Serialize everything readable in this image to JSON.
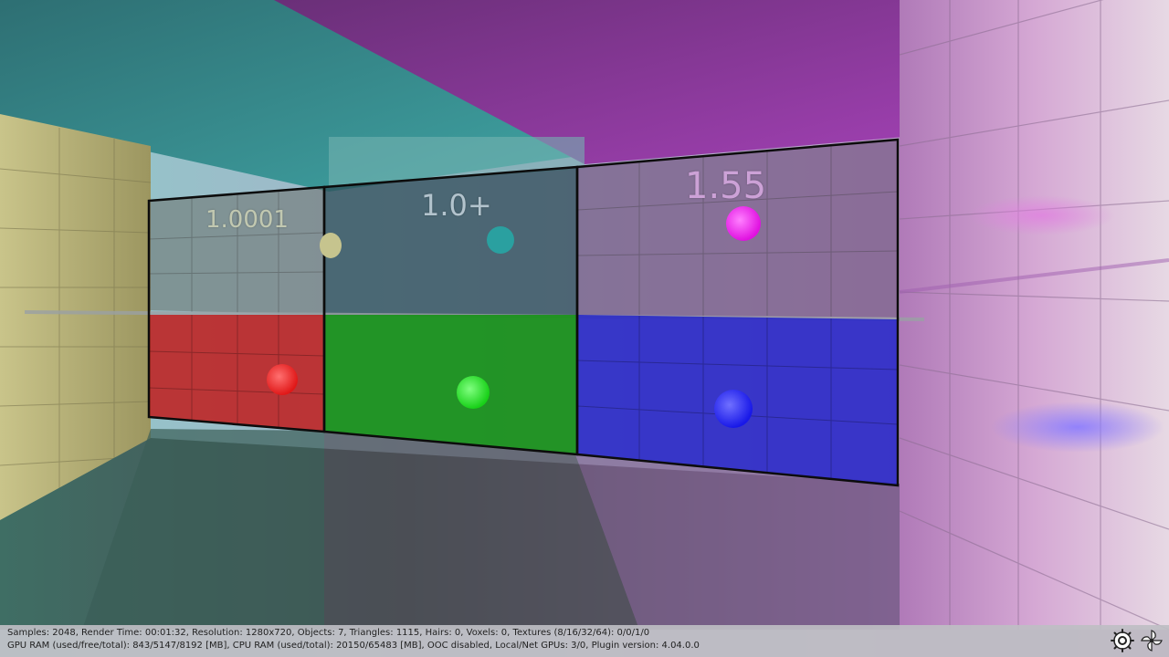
{
  "viewport": {
    "ior_labels": {
      "left": "1.0001",
      "middle": "1.0+",
      "right": "1.55"
    }
  },
  "status_bar": {
    "line1": "Samples: 2048, Render Time: 00:01:32, Resolution: 1280x720, Objects: 7, Triangles: 1115, Hairs: 0, Voxels: 0, Textures (8/16/32/64): 0/0/1/0",
    "line2": "GPU RAM (used/free/total): 843/5147/8192 [MB], CPU RAM (used/total): 20150/65483 [MB], OOC disabled, Local/Net GPUs: 3/0, Plugin version: 4.04.0.0"
  },
  "icons": {
    "logo_left": "octane-logo-icon",
    "logo_right": "octane-spinner-icon"
  }
}
